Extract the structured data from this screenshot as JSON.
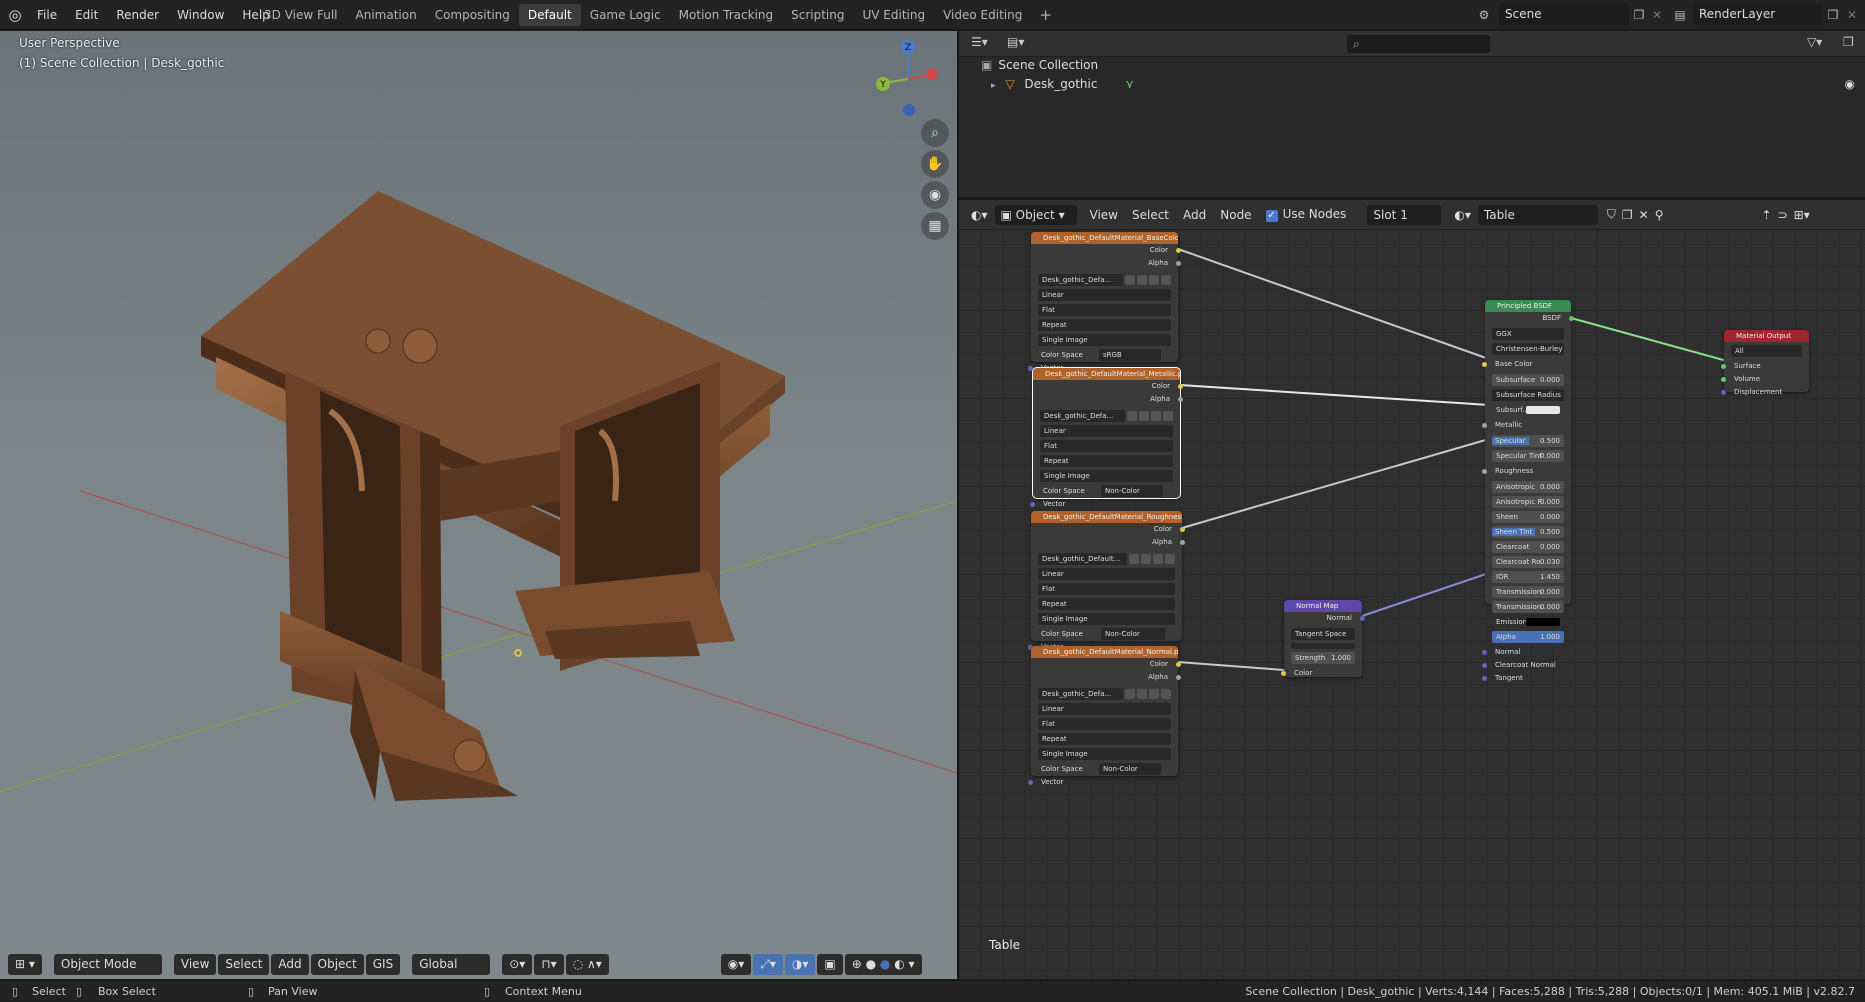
{
  "menu": [
    "File",
    "Edit",
    "Render",
    "Window",
    "Help"
  ],
  "workspace_tabs": [
    {
      "label": "3D View Full",
      "active": false
    },
    {
      "label": "Animation",
      "active": false
    },
    {
      "label": "Compositing",
      "active": false
    },
    {
      "label": "Default",
      "active": true
    },
    {
      "label": "Game Logic",
      "active": false
    },
    {
      "label": "Motion Tracking",
      "active": false
    },
    {
      "label": "Scripting",
      "active": false
    },
    {
      "label": "UV Editing",
      "active": false
    },
    {
      "label": "Video Editing",
      "active": false
    }
  ],
  "scene": {
    "name": "Scene"
  },
  "render_layer": {
    "name": "RenderLayer"
  },
  "viewport": {
    "title": "User Perspective",
    "subtitle": "(1) Scene Collection | Desk_gothic",
    "gizmo": {
      "z": "Z",
      "y": "Y"
    },
    "footer": {
      "mode": "Object Mode",
      "view": "View",
      "select": "Select",
      "add": "Add",
      "object": "Object",
      "gis": "GIS",
      "orientation": "Global"
    }
  },
  "outliner": {
    "root": "Scene Collection",
    "item": "Desk_gothic"
  },
  "node_editor": {
    "header": {
      "type": "Object",
      "view": "View",
      "select": "Select",
      "add": "Add",
      "node": "Node",
      "use_nodes": "Use Nodes",
      "slot": "Slot 1",
      "material": "Table"
    },
    "label": "Table",
    "tex_basecolor": {
      "title": "Desk_gothic_DefaultMaterial_BaseColor.p...",
      "image": "Desk_gothic_Defa...",
      "interp": "Linear",
      "proj": "Flat",
      "ext": "Repeat",
      "source": "Single Image",
      "cs_label": "Color Space",
      "cs": "sRGB"
    },
    "tex_metallic": {
      "title": "Desk_gothic_DefaultMaterial_Metallic.png",
      "image": "Desk_gothic_Defa...",
      "interp": "Linear",
      "proj": "Flat",
      "ext": "Repeat",
      "source": "Single Image",
      "cs_label": "Color Space",
      "cs": "Non-Color"
    },
    "tex_roughness": {
      "title": "Desk_gothic_DefaultMaterial_Roughness.p...",
      "image": "Desk_gothic_Default...",
      "interp": "Linear",
      "proj": "Flat",
      "ext": "Repeat",
      "source": "Single Image",
      "cs_label": "Color Space",
      "cs": "Non-Color"
    },
    "tex_normal": {
      "title": "Desk_gothic_DefaultMaterial_Normal.png",
      "image": "Desk_gothic_Defa...",
      "interp": "Linear",
      "proj": "Flat",
      "ext": "Repeat",
      "source": "Single Image",
      "cs_label": "Color Space",
      "cs": "Non-Color"
    },
    "tex_labels": {
      "color": "Color",
      "alpha": "Alpha",
      "vector": "Vector"
    },
    "normal_map": {
      "title": "Normal Map",
      "out": "Normal",
      "space": "Tangent Space",
      "strength_label": "Strength",
      "strength": "1.000",
      "color": "Color"
    },
    "bsdf": {
      "title": "Principled BSDF",
      "out": "BSDF",
      "dist": "GGX",
      "sss": "Christensen-Burley",
      "base_color": "Base Color",
      "subsurface": {
        "label": "Subsurface",
        "value": "0.000"
      },
      "ss_radius": "Subsurface Radius",
      "ss_color": "Subsurf...",
      "metallic": "Metallic",
      "specular": {
        "label": "Specular",
        "value": "0.500"
      },
      "spec_tint": {
        "label": "Specular Tint",
        "value": "0.000"
      },
      "roughness": "Roughness",
      "aniso": {
        "label": "Anisotropic",
        "value": "0.000"
      },
      "aniso_rot": {
        "label": "Anisotropic R",
        "value": "0.000"
      },
      "sheen": {
        "label": "Sheen",
        "value": "0.000"
      },
      "sheen_tint": {
        "label": "Sheen Tint",
        "value": "0.500"
      },
      "clearcoat": {
        "label": "Clearcoat",
        "value": "0.000"
      },
      "clearcoat_r": {
        "label": "Clearcoat Ro",
        "value": "0.030"
      },
      "ior": {
        "label": "IOR",
        "value": "1.450"
      },
      "transmission": {
        "label": "Transmission",
        "value": "0.000"
      },
      "transmission_r": {
        "label": "Transmission",
        "value": "0.000"
      },
      "emission": "Emission",
      "alpha": {
        "label": "Alpha",
        "value": "1.000"
      },
      "normal": "Normal",
      "clearcoat_normal": "Clearcoat Normal",
      "tangent": "Tangent"
    },
    "output": {
      "title": "Material Output",
      "target": "All",
      "surface": "Surface",
      "volume": "Volume",
      "displacement": "Displacement"
    }
  },
  "statusbar": {
    "select": "Select",
    "box_select": "Box Select",
    "pan": "Pan View",
    "context": "Context Menu",
    "info": "Scene Collection | Desk_gothic | Verts:4,144 | Faces:5,288 | Tris:5,288 | Objects:0/1 | Mem: 405.1 MiB | v2.82.7"
  },
  "colors": {
    "accent": "#4772b3",
    "texture_header": "#b0622b",
    "shader_header": "#3a8a53",
    "output_header": "#a0262e",
    "vector_header": "#5e48a9",
    "wood": "#8a5a35"
  },
  "icons": [
    "blender-logo-icon",
    "search-icon",
    "eye-icon",
    "mesh-icon",
    "filter-icon",
    "zoom-icon",
    "pan-hand-icon",
    "camera-icon",
    "grid-icon",
    "mouse-icon"
  ]
}
